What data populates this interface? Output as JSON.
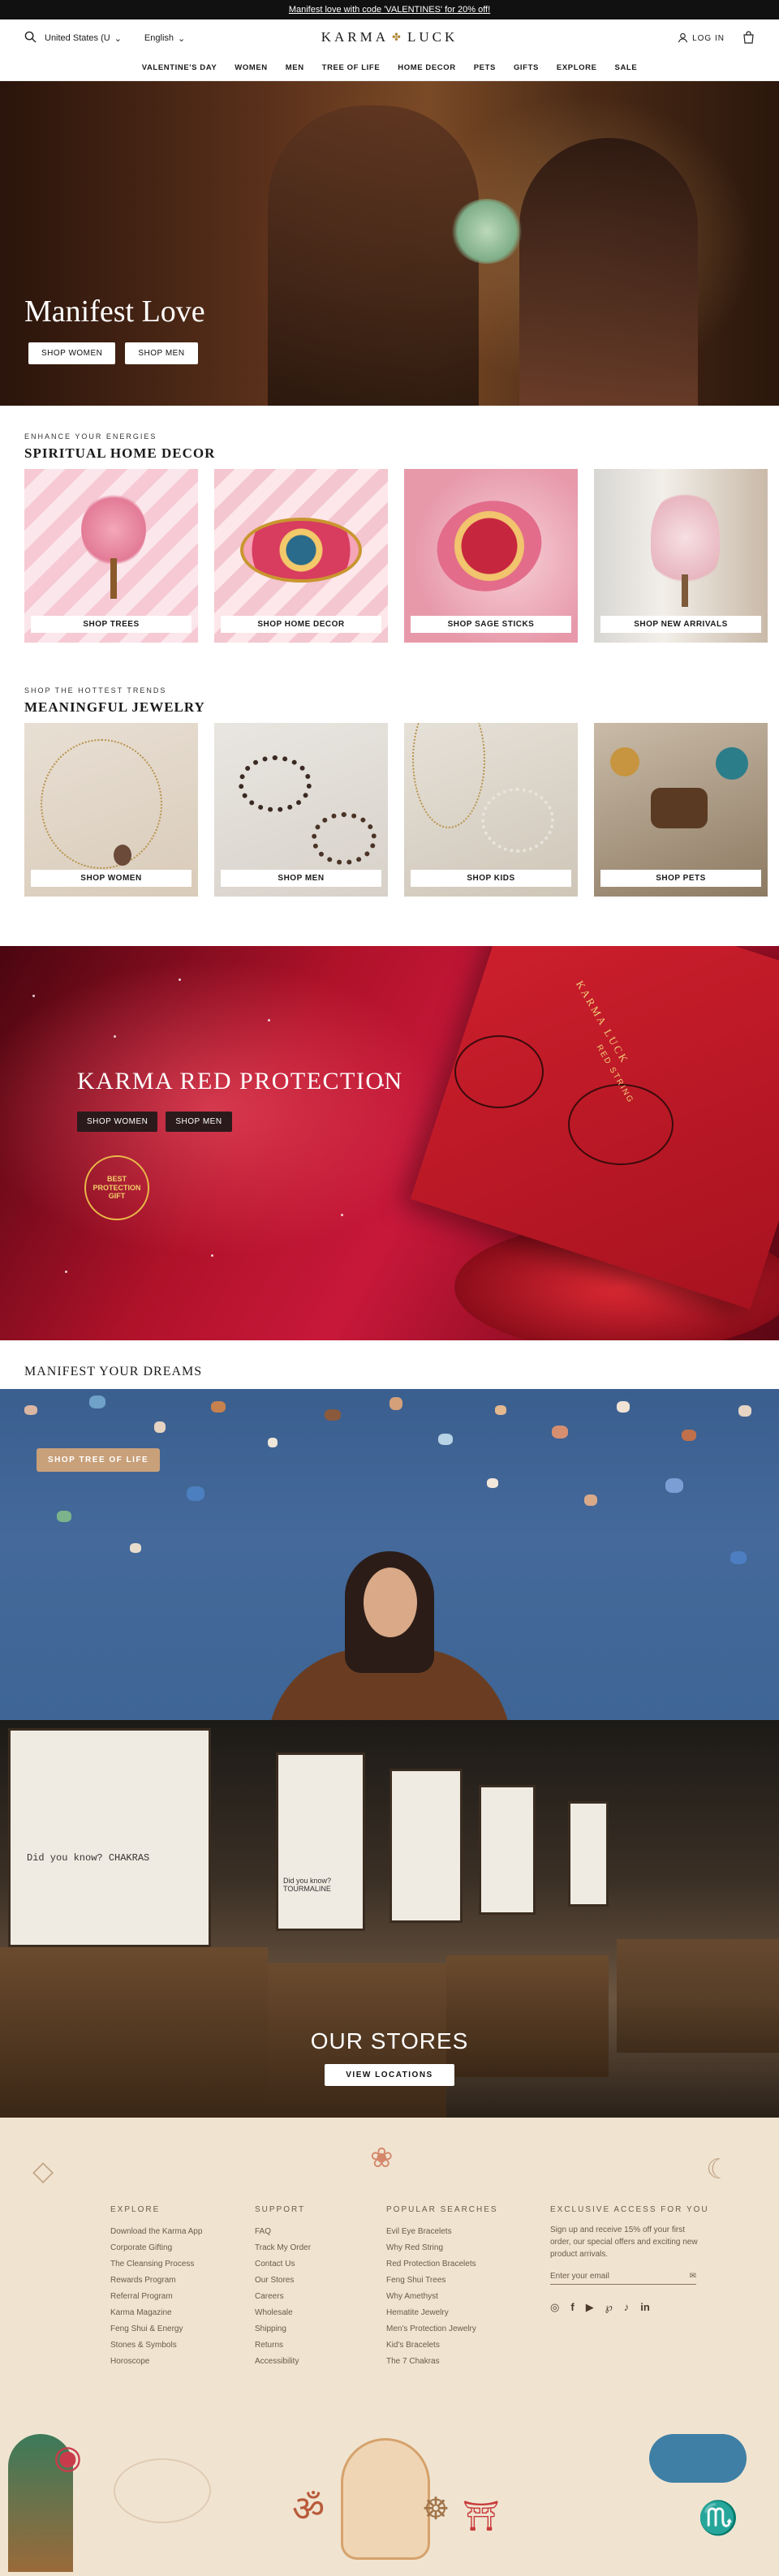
{
  "announcement": "Manifest love with code 'VALENTINES' for 20% off!",
  "header": {
    "country": "United States (U",
    "language": "English",
    "logo": "KARMA",
    "logo_right": "LUCK",
    "login": "LOG IN"
  },
  "nav": [
    "VALENTINE'S DAY",
    "WOMEN",
    "MEN",
    "TREE OF LIFE",
    "HOME DECOR",
    "PETS",
    "GIFTS",
    "EXPLORE",
    "SALE"
  ],
  "hero": {
    "title": "Manifest Love",
    "btn_women": "SHOP WOMEN",
    "btn_men": "SHOP MEN"
  },
  "decor": {
    "eyebrow": "ENHANCE YOUR ENERGIES",
    "title": "SPIRITUAL HOME DECOR",
    "tiles": [
      "SHOP TREES",
      "SHOP HOME DECOR",
      "SHOP SAGE STICKS",
      "SHOP NEW ARRIVALS"
    ]
  },
  "jewelry": {
    "eyebrow": "SHOP THE HOTTEST TRENDS",
    "title": "MEANINGFUL JEWELRY",
    "tiles": [
      "SHOP WOMEN",
      "SHOP MEN",
      "SHOP KIDS",
      "SHOP PETS"
    ]
  },
  "red": {
    "title": "KARMA RED PROTECTION",
    "btn_women": "SHOP WOMEN",
    "btn_men": "SHOP MEN",
    "badge": "BEST PROTECTION GIFT",
    "box_brand": "KARMA LUCK",
    "box_sub": "RED STRING"
  },
  "dreams": {
    "title": "MANIFEST YOUR DREAMS",
    "btn": "SHOP TREE OF LIFE"
  },
  "stores": {
    "poster1": "Did you know? CHAKRAS",
    "poster2": "Did you know? TOURMALINE",
    "title": "OUR STORES",
    "btn": "VIEW LOCATIONS"
  },
  "footer": {
    "explore": {
      "heading": "EXPLORE",
      "items": [
        "Download the Karma App",
        "Corporate Gifting",
        "The Cleansing Process",
        "Rewards Program",
        "Referral Program",
        "Karma Magazine",
        "Feng Shui & Energy",
        "Stones & Symbols",
        "Horoscope"
      ]
    },
    "support": {
      "heading": "SUPPORT",
      "items": [
        "FAQ",
        "Track My Order",
        "Contact Us",
        "Our Stores",
        "Careers",
        "Wholesale",
        "Shipping",
        "Returns",
        "Accessibility"
      ]
    },
    "popular": {
      "heading": "POPULAR SEARCHES",
      "items": [
        "Evil Eye Bracelets",
        "Why Red String",
        "Red Protection Bracelets",
        "Feng Shui Trees",
        "Why Amethyst",
        "Hematite Jewelry",
        "Men's Protection Jewelry",
        "Kid's Bracelets",
        "The 7 Chakras"
      ]
    },
    "exclusive": {
      "heading": "EXCLUSIVE ACCESS FOR YOU",
      "text": "Sign up and receive 15% off your first order, our special offers and exciting new product arrivals.",
      "placeholder": "Enter your email"
    },
    "social_icons": [
      "instagram-icon",
      "facebook-icon",
      "youtube-icon",
      "pinterest-icon",
      "tiktok-icon",
      "linkedin-icon"
    ]
  }
}
